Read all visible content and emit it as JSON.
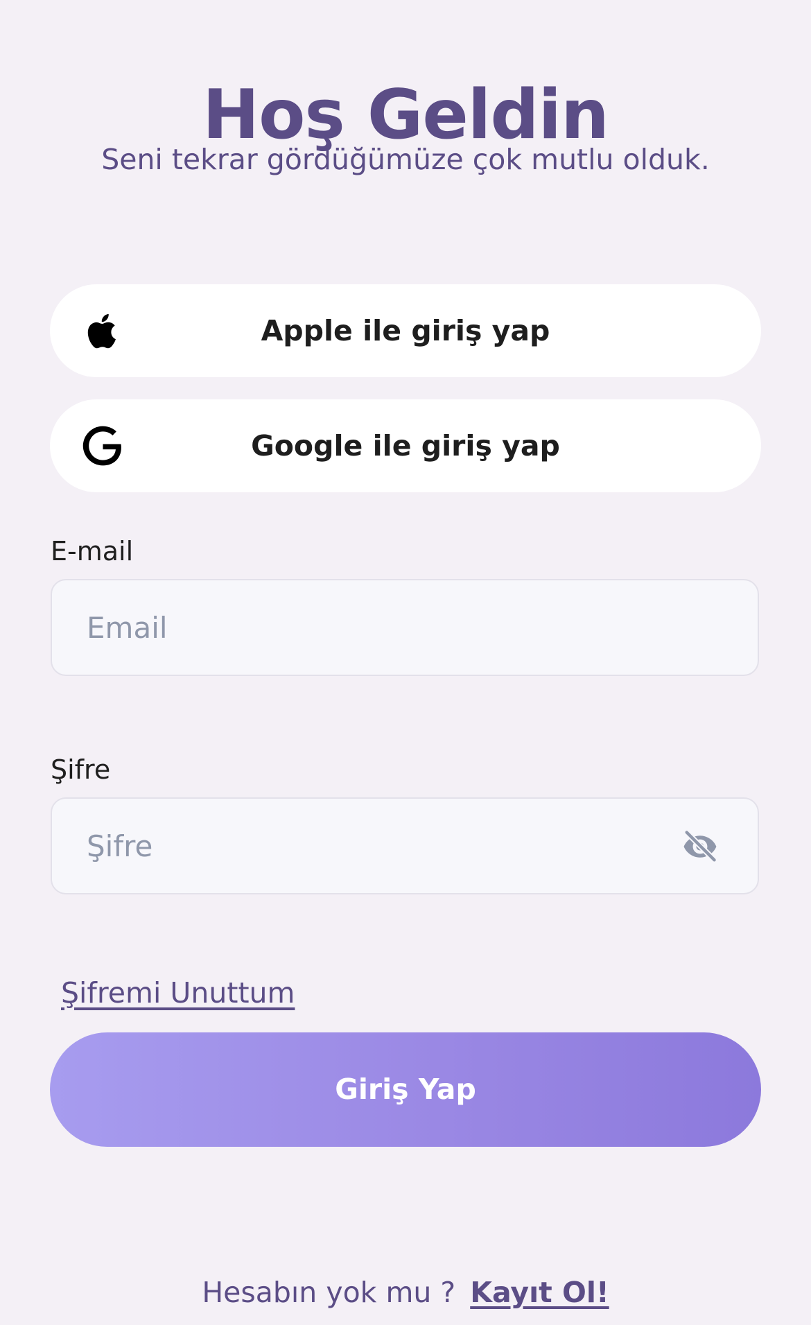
{
  "header": {
    "title": "Hoş Geldin",
    "subtitle": "Seni tekrar gördüğümüze çok mutlu olduk."
  },
  "social": {
    "apple_label": "Apple ile giriş yap",
    "google_label": "Google ile giriş yap"
  },
  "form": {
    "email_label": "E-mail",
    "email_placeholder": "Email",
    "email_value": "",
    "password_label": "Şifre",
    "password_placeholder": "Şifre",
    "password_value": ""
  },
  "links": {
    "forgot_password": "Şifremi Unuttum"
  },
  "actions": {
    "login_label": "Giriş Yap"
  },
  "footer": {
    "prompt": "Hesabın yok mu ?",
    "signup": "Kayıt Ol!"
  },
  "icons": {
    "apple": "apple-logo",
    "google": "google-logo",
    "password_toggle": "eye-slash"
  },
  "colors": {
    "background": "#f4f0f6",
    "heading": "#5b4d86",
    "button_gradient_start": "#a79cef",
    "button_gradient_end": "#8c79dc"
  }
}
